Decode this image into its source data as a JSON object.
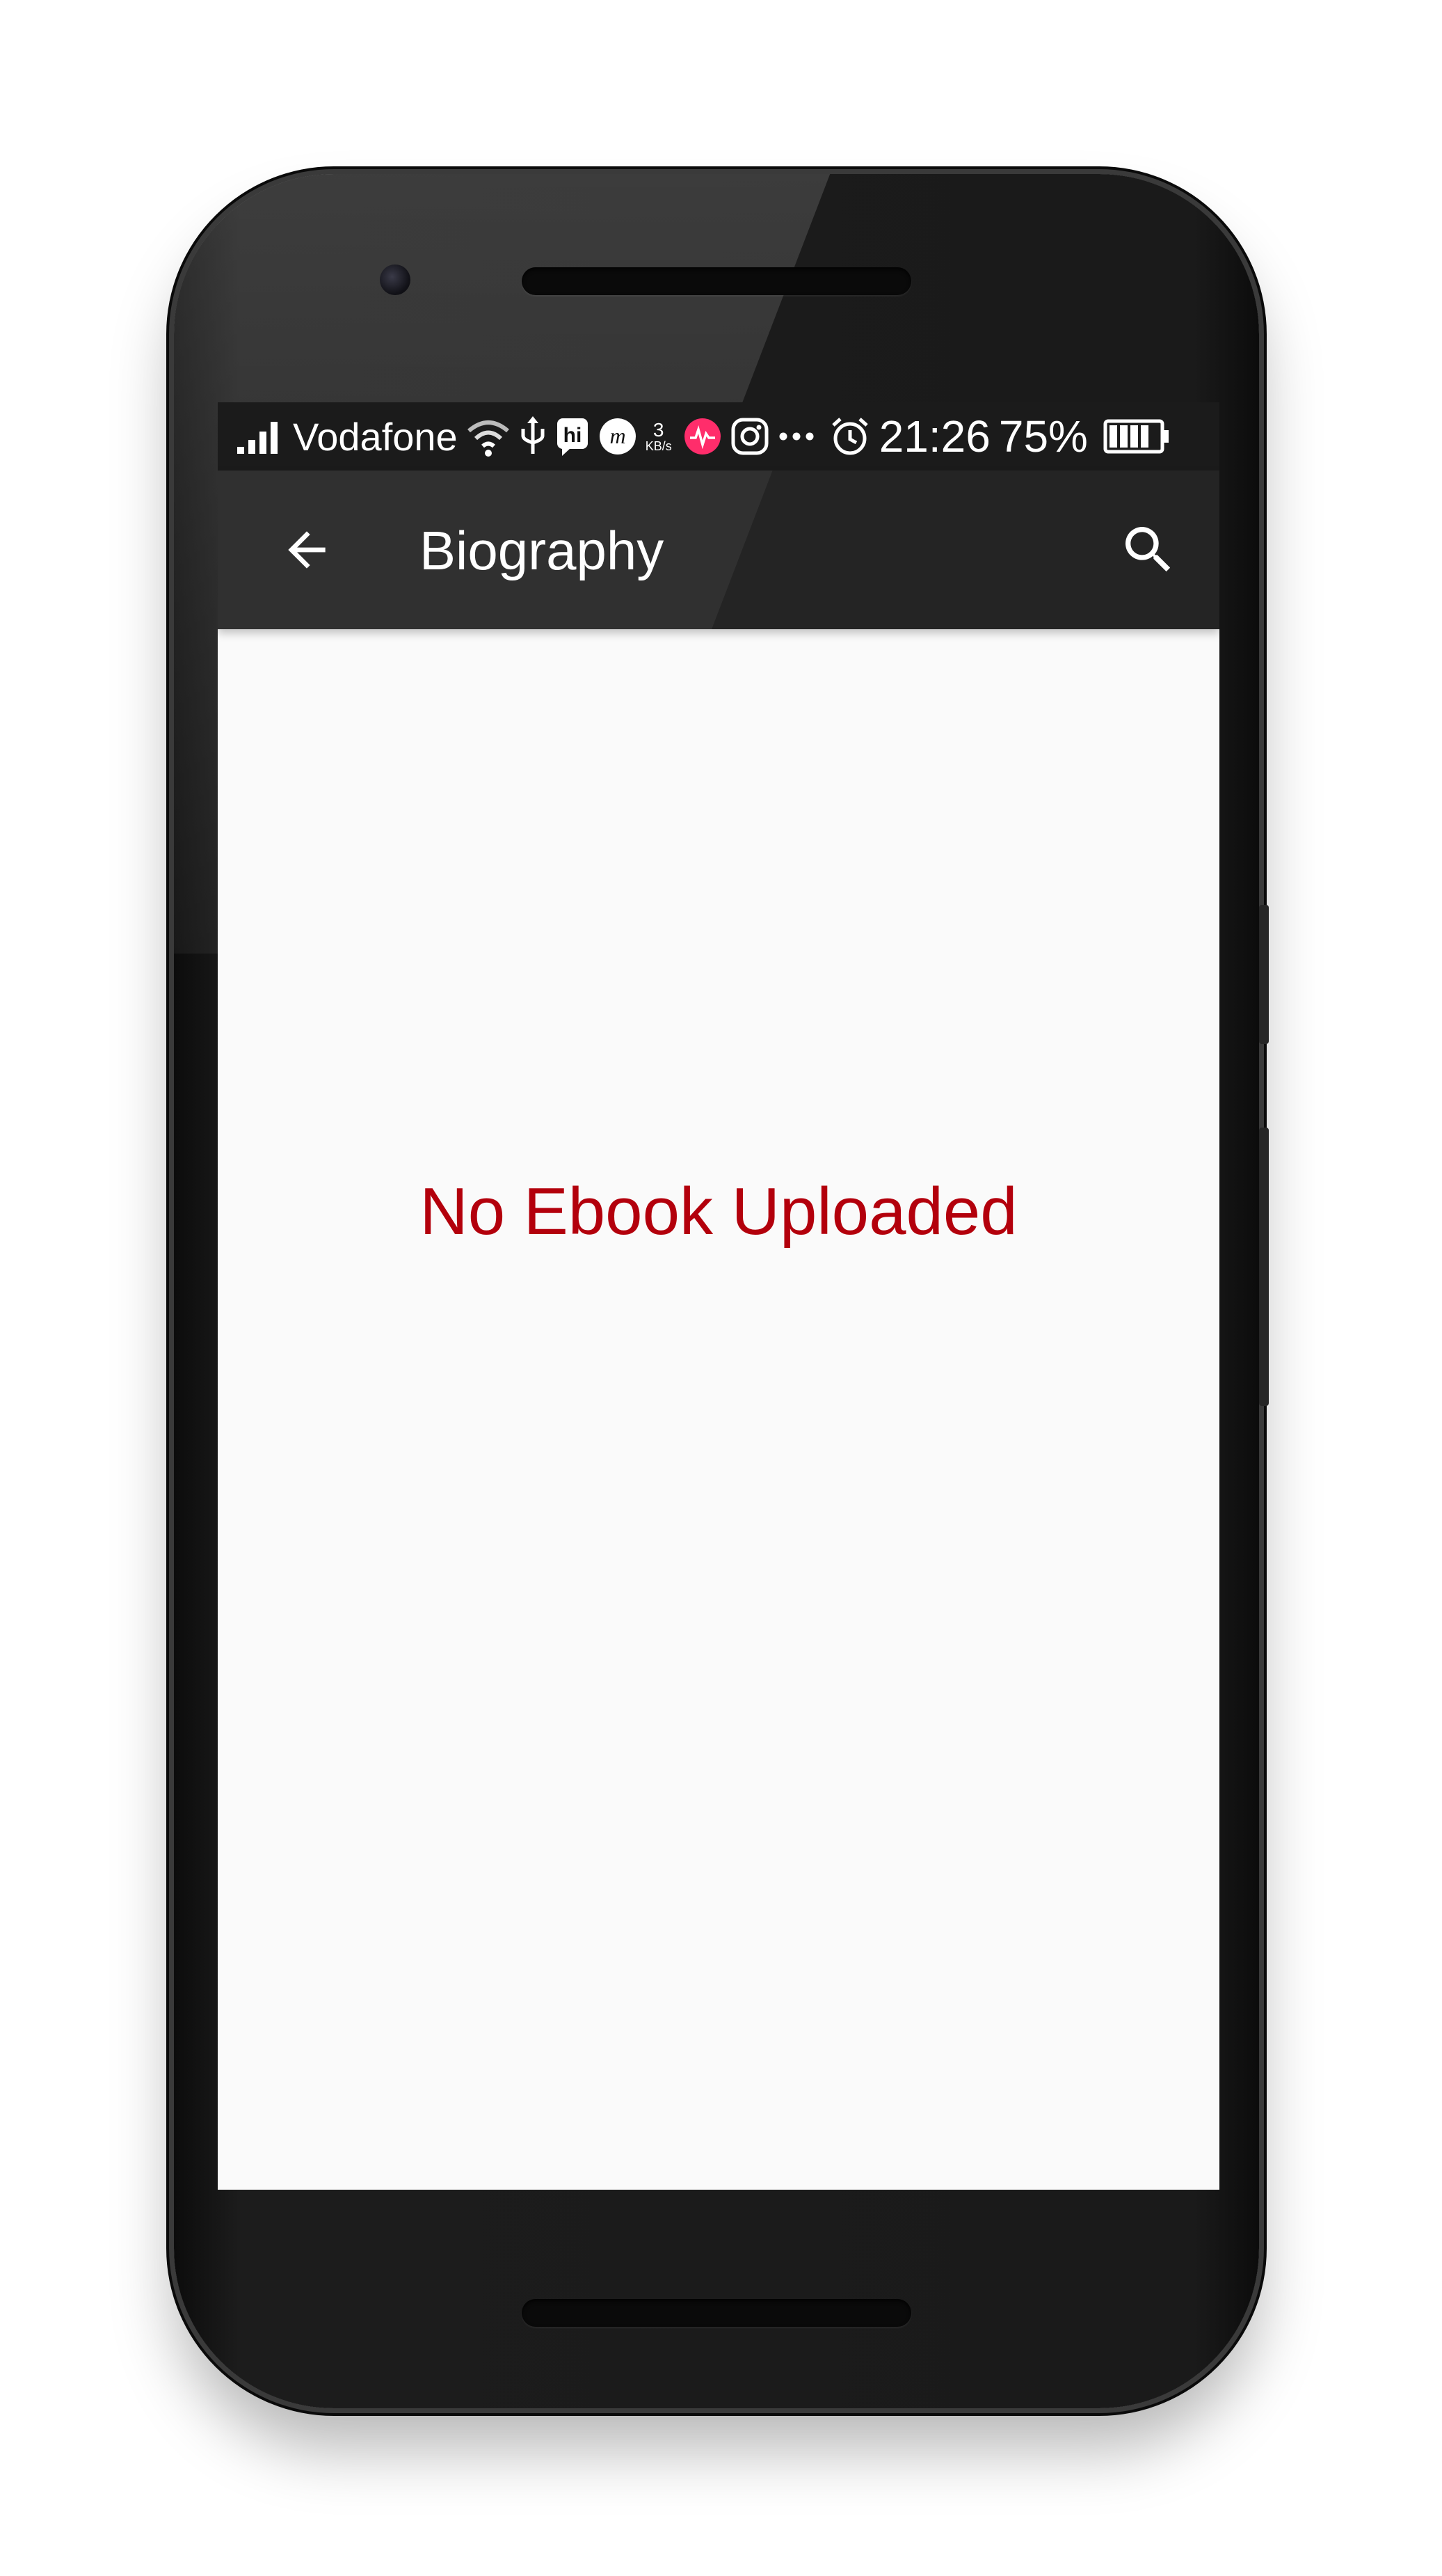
{
  "status_bar": {
    "carrier": "Vodafone",
    "network_speed_value": "3",
    "network_speed_unit": "KB/s",
    "time": "21:26",
    "battery_percent": "75%",
    "battery_level": 0.75,
    "icons": [
      "signal-icon",
      "wifi-icon",
      "usb-icon",
      "hike-icon",
      "musically-icon",
      "speed-icon",
      "music-app-icon",
      "instagram-icon",
      "more-icon",
      "alarm-icon",
      "battery-icon"
    ]
  },
  "app_bar": {
    "title": "Biography",
    "back_icon": "arrow-back-icon",
    "search_icon": "search-icon",
    "background": "#242424"
  },
  "content": {
    "empty_message": "No Ebook Uploaded",
    "message_color": "#b3000c",
    "background": "#fafafa"
  }
}
